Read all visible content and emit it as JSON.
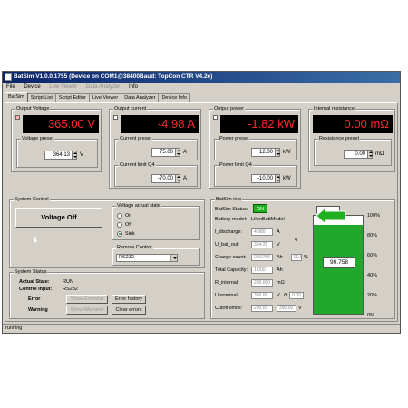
{
  "window": {
    "title": "BatSim V1.0.0.1755 (Device on COM1@38400Baud: TopCon CTR V4.2e)"
  },
  "menu": [
    "File",
    "Device",
    "Live Viewer",
    "Data Analyzer",
    "Info"
  ],
  "tabs": [
    "BatSim",
    "Script List",
    "Script Editor",
    "Live Viewer",
    "Data Analyzer",
    "Device Info"
  ],
  "output_voltage": {
    "group": "Output Voltage",
    "display": "365.00 V",
    "preset_label": "Voltage preset",
    "preset_value": "364.13",
    "unit": "V"
  },
  "output_current": {
    "group": "Output current",
    "display": "-4.98 A",
    "preset_label": "Current preset",
    "preset_value": "75.00",
    "unit": "A",
    "limit_label": "Current limit Q4",
    "limit_value": "-70.00",
    "limit_unit": "A"
  },
  "output_power": {
    "group": "Output power",
    "display": "-1.82 kW",
    "preset_label": "Power preset",
    "preset_value": "12.00",
    "unit": "kW",
    "limit_label": "Power limit Q4",
    "limit_value": "-10.00",
    "limit_unit": "kW"
  },
  "internal_resistance": {
    "group": "Internal resistance",
    "display": "0.00 mΩ",
    "preset_label": "Resistance preset",
    "preset_value": "0.00",
    "unit": "mΩ"
  },
  "system_control": {
    "group": "System Control",
    "voltage_button": "Voltage Off",
    "actual_state_group": "Voltage actual state",
    "states": [
      "On",
      "Off",
      "Sink"
    ],
    "selected_state": "Sink",
    "remote_group": "Remote Control",
    "remote_value": "RS232"
  },
  "system_status": {
    "group": "System Status",
    "actual_state_label": "Actual State:",
    "actual_state_value": "RUN",
    "control_input_label": "Control Input:",
    "control_input_value": "RS232",
    "error_label": "Error",
    "warning_label": "Warning",
    "show_errorstat": "Show Errorstat",
    "show_warnstat": "Show Warnstat",
    "error_history": "Error history",
    "clear_errors": "Clear errors"
  },
  "batsim_info": {
    "group": "BatSim info",
    "status_label": "BatSim Status:",
    "status_value": "ON",
    "model_label": "Battery model:",
    "model_value": "LiIonBattModel",
    "discharge_label": "I_discharge:",
    "discharge_value": "4.980",
    "discharge_unit": "A",
    "ubat_label": "U_bat_out:",
    "ubat_value": "364.25",
    "ubat_unit": "V",
    "eta_symbol": "η",
    "charge_label": "Charge count:",
    "charge_value": "0.90756",
    "charge_unit": "Ah",
    "charge_pct": "90.8",
    "charge_pct_unit": "%",
    "capacity_label": "Total Capacity:",
    "capacity_value": "1.000",
    "capacity_unit": "Ah",
    "rint_label": "R_internal:",
    "rint_value": "200.000",
    "rint_unit": "mΩ",
    "unom_label": "U nominal:",
    "unom_value": "350.00",
    "unom_unit": "V",
    "temp_symbol": "ϑ",
    "temp_value": "0.00",
    "cutoff_label": "Cutoff limits:",
    "cutoff_low": "200.00",
    "cutoff_high": "390.00",
    "cutoff_unit": "V"
  },
  "battery_gauge": {
    "fill_fraction": 0.90758,
    "value_text": "90.758",
    "ticks": [
      "100%",
      "80%",
      "60%",
      "40%",
      "20%",
      "0%"
    ],
    "fill_color": "#1fa82a",
    "arrow_color": "#20b020"
  },
  "statusbar": {
    "text": "running"
  }
}
